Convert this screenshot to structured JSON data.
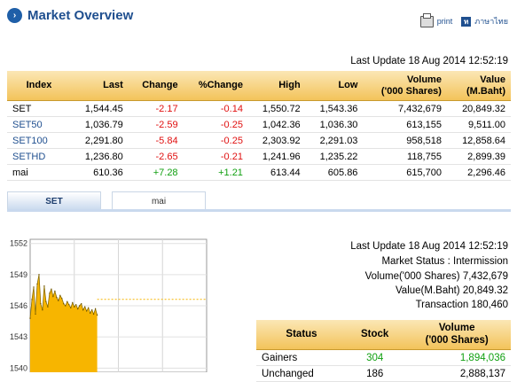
{
  "header": {
    "title": "Market Overview",
    "print_label": "print",
    "language_label": "ภาษาไทย"
  },
  "index_table": {
    "last_update": "Last Update 18 Aug 2014 12:52:19",
    "headers": [
      "Index",
      "Last",
      "Change",
      "%Change",
      "High",
      "Low",
      "Volume\n('000 Shares)",
      "Value\n(M.Baht)"
    ],
    "rows": [
      {
        "index": "SET",
        "last": "1,544.45",
        "change": "-2.17",
        "pct": "-0.14",
        "high": "1,550.72",
        "low": "1,543.36",
        "volume": "7,432,679",
        "value": "20,849.32",
        "dir": "neg",
        "link": false
      },
      {
        "index": "SET50",
        "last": "1,036.79",
        "change": "-2.59",
        "pct": "-0.25",
        "high": "1,042.36",
        "low": "1,036.30",
        "volume": "613,155",
        "value": "9,511.00",
        "dir": "neg",
        "link": true
      },
      {
        "index": "SET100",
        "last": "2,291.80",
        "change": "-5.84",
        "pct": "-0.25",
        "high": "2,303.92",
        "low": "2,291.03",
        "volume": "958,518",
        "value": "12,858.64",
        "dir": "neg",
        "link": true
      },
      {
        "index": "SETHD",
        "last": "1,236.80",
        "change": "-2.65",
        "pct": "-0.21",
        "high": "1,241.96",
        "low": "1,235.22",
        "volume": "118,755",
        "value": "2,899.39",
        "dir": "neg",
        "link": true
      },
      {
        "index": "mai",
        "last": "610.36",
        "change": "+7.28",
        "pct": "+1.21",
        "high": "613.44",
        "low": "605.86",
        "volume": "615,700",
        "value": "2,296.46",
        "dir": "pos",
        "link": false
      }
    ]
  },
  "tabs": [
    {
      "label": "SET",
      "active": true
    },
    {
      "label": "mai",
      "active": false
    }
  ],
  "chart_data": {
    "type": "area",
    "title": "",
    "xlabel": "",
    "ylabel": "",
    "y_ticks": [
      1552,
      1549,
      1546,
      1543,
      1540
    ],
    "ylim": [
      1539.6,
      1552.4
    ],
    "x_sessions": 4,
    "reference_level": 1546.62,
    "values": [
      1544.8,
      1546.6,
      1547.8,
      1545.2,
      1548.1,
      1549.0,
      1546.2,
      1545.6,
      1547.9,
      1546.4,
      1545.9,
      1547.2,
      1547.6,
      1546.9,
      1547.4,
      1546.8,
      1546.5,
      1547.0,
      1546.7,
      1546.2,
      1546.0,
      1546.4,
      1546.1,
      1545.8,
      1546.3,
      1545.9,
      1546.1,
      1545.7,
      1546.0,
      1546.2,
      1545.6,
      1545.9,
      1545.5,
      1545.8,
      1545.3,
      1545.6,
      1545.2,
      1545.7,
      1545.1
    ],
    "area_color": "#f7b500",
    "reference_color": "#f7b500"
  },
  "market_status": {
    "last_update": "Last Update 18 Aug 2014 12:52:19",
    "status": "Market Status : Intermission",
    "volume": "Volume('000 Shares) 7,432,679",
    "value": "Value(M.Baht) 20,849.32",
    "transaction": "Transaction 180,460"
  },
  "stock_status_table": {
    "headers": [
      "Status",
      "Stock",
      "Volume\n('000 Shares)"
    ],
    "rows": [
      {
        "status": "Gainers",
        "stock": "304",
        "volume": "1,894,036",
        "dir": "pos"
      },
      {
        "status": "Unchanged",
        "stock": "186",
        "volume": "2,888,137",
        "dir": "none"
      }
    ]
  },
  "colors": {
    "title": "#1f4f8f",
    "negative": "#e01010",
    "positive": "#11a011",
    "header_gold": "#f3c35a"
  }
}
